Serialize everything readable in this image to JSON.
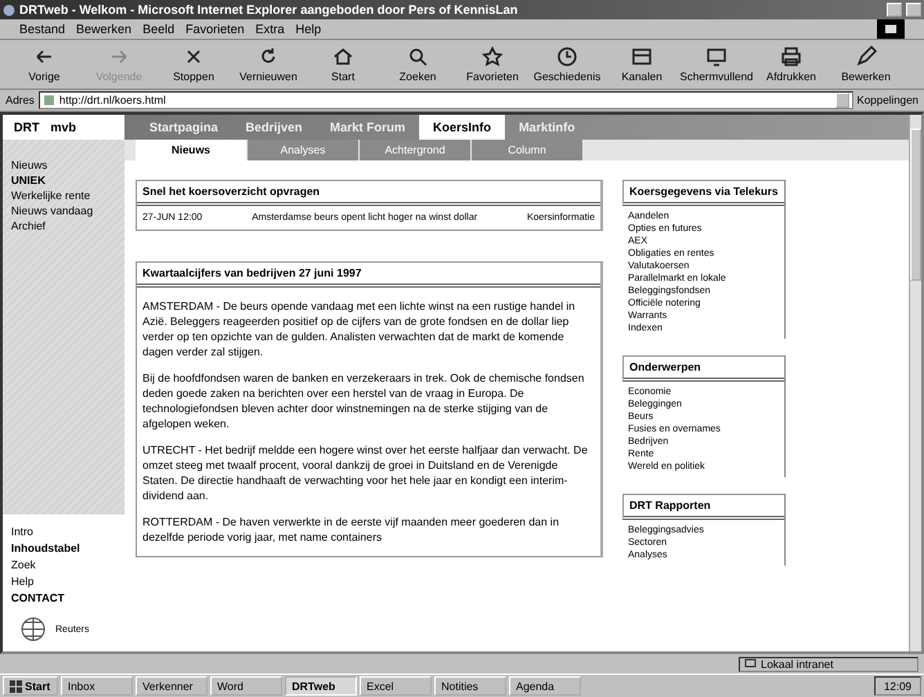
{
  "window": {
    "title": "DRTweb - Welkom - Microsoft Internet Explorer aangeboden door Pers of KennisLan"
  },
  "menu": [
    "Bestand",
    "Bewerken",
    "Beeld",
    "Favorieten",
    "Extra",
    "Help"
  ],
  "toolbar": [
    {
      "label": "Vorige",
      "disabled": false
    },
    {
      "label": "Volgende",
      "disabled": true
    },
    {
      "label": "Stoppen",
      "disabled": false
    },
    {
      "label": "Vernieuwen",
      "disabled": false
    },
    {
      "label": "Start",
      "disabled": false
    },
    {
      "label": "Zoeken",
      "disabled": false
    },
    {
      "label": "Favorieten",
      "disabled": false
    },
    {
      "label": "Geschiedenis",
      "disabled": false
    },
    {
      "label": "Kanalen",
      "disabled": false
    },
    {
      "label": "Schermvullend",
      "disabled": false
    },
    {
      "label": "Afdrukken",
      "disabled": false
    },
    {
      "label": "Bewerken",
      "disabled": false
    }
  ],
  "address": {
    "label": "Adres",
    "value": "http://drt.nl/koers.html",
    "links_label": "Koppelingen"
  },
  "site": {
    "logo": {
      "left": "DRT",
      "right": "mvb"
    },
    "nav": [
      {
        "label": "Startpagina",
        "selected": false
      },
      {
        "label": "Bedrijven",
        "selected": false
      },
      {
        "label": "Markt Forum",
        "selected": false
      },
      {
        "label": "KoersInfo",
        "selected": true
      },
      {
        "label": "Marktinfo",
        "selected": false
      }
    ],
    "subnav": [
      {
        "label": "Nieuws",
        "selected": true
      },
      {
        "label": "Analyses",
        "selected": false
      },
      {
        "label": "Achtergrond",
        "selected": false
      },
      {
        "label": "Column",
        "selected": false
      }
    ],
    "sidebar_top": [
      "Nieuws",
      "UNIEK",
      "Werkelijke rente",
      "Nieuws vandaag",
      "Archief"
    ],
    "sidebar_bottom": [
      "Intro",
      "Inhoudstabel",
      "Zoek",
      "Help",
      "CONTACT"
    ],
    "sidebar_logo": "Reuters",
    "quote_box": {
      "title": "Snel het koersoverzicht opvragen",
      "time": "27-JUN 12:00",
      "text": "Amsterdamse beurs opent licht hoger na winst dollar",
      "link": "Koersinformatie"
    },
    "article": {
      "title": "Kwartaalcijfers van bedrijven 27 juni 1997",
      "paragraphs": [
        "AMSTERDAM - De beurs opende vandaag met een lichte winst na een rustige handel in Azië. Beleggers reageerden positief op de cijfers van de grote fondsen en de dollar liep verder op ten opzichte van de gulden. Analisten verwachten dat de markt de komende dagen verder zal stijgen.",
        "Bij de hoofdfondsen waren de banken en verzekeraars in trek. Ook de chemische fondsen deden goede zaken na berichten over een herstel van de vraag in Europa. De technologiefondsen bleven achter door winstnemingen na de sterke stijging van de afgelopen weken.",
        "UTRECHT - Het bedrijf meldde een hogere winst over het eerste halfjaar dan verwacht. De omzet steeg met twaalf procent, vooral dankzij de groei in Duitsland en de Verenigde Staten. De directie handhaaft de verwachting voor het hele jaar en kondigt een interim-dividend aan.",
        "ROTTERDAM - De haven verwerkte in de eerste vijf maanden meer goederen dan in dezelfde periode vorig jaar, met name containers"
      ]
    },
    "boxes": [
      {
        "title": "Koersgegevens via Telekurs",
        "items": [
          "Aandelen",
          "Opties en futures",
          "AEX",
          "Obligaties en rentes",
          "Valutakoersen",
          "Parallelmarkt en lokale",
          "Beleggingsfondsen",
          "Officiële notering",
          "Warrants",
          "Indexen"
        ]
      },
      {
        "title": "Onderwerpen",
        "items": [
          "Economie",
          "Beleggingen",
          "Beurs",
          "Fusies en overnames",
          "Bedrijven",
          "Rente",
          "Wereld en politiek"
        ]
      },
      {
        "title": "DRT Rapporten",
        "items": [
          "Beleggingsadvies",
          "Sectoren",
          "Analyses"
        ]
      }
    ]
  },
  "status": {
    "zone": "Lokaal intranet"
  },
  "taskbar": {
    "start": "Start",
    "tasks": [
      {
        "label": "Inbox",
        "selected": false
      },
      {
        "label": "Verkenner",
        "selected": false
      },
      {
        "label": "Word",
        "selected": false
      },
      {
        "label": "DRTweb",
        "selected": true
      },
      {
        "label": "Excel",
        "selected": false
      },
      {
        "label": "Notities",
        "selected": false
      },
      {
        "label": "Agenda",
        "selected": false
      }
    ],
    "clock": "12:09"
  }
}
